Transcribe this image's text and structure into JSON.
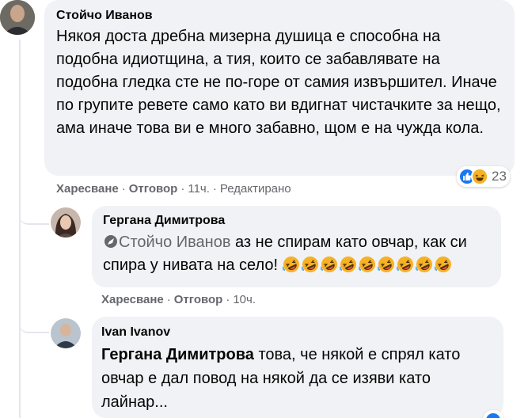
{
  "comments": [
    {
      "author": "Стойчо Иванов",
      "text": "Някоя доста дребна мизерна душица е способна на подобна идиотщина, а тия, които се забавлявате на подобна гледка сте не по-горе от самия извършител. Иначе по групите ревете само като ви вдигнат чистачките за нещо, ама иначе това ви е много забавно, щом е на чужда кола.",
      "like_label": "Харесване",
      "reply_label": "Отговор",
      "time": "11ч.",
      "edited_label": "Редактирано",
      "reaction_count": "23"
    },
    {
      "author": "Гергана Димитрова",
      "mention": "Стойчо Иванов",
      "text": " аз не спирам като овчар, как си спира у нивата на село! ",
      "emoji_count": 9,
      "like_label": "Харесване",
      "reply_label": "Отговор",
      "time": "10ч."
    },
    {
      "author": "Ivan Ivanov",
      "mention": "Гергана Димитрова",
      "text": " това, че някой е спрял като овчар е дал повод на някой да се изяви като лайнар..."
    }
  ],
  "colors": {
    "like_blue": "#1877f2",
    "haha_yellow": "#f7b125",
    "bubble_bg": "#f0f2f5",
    "meta_gray": "#65676b"
  },
  "icons": {
    "reaction_like": "thumbs-up-icon",
    "reaction_haha": "laughing-face-icon",
    "emoji": "rolling-on-floor-laughing-emoji"
  }
}
